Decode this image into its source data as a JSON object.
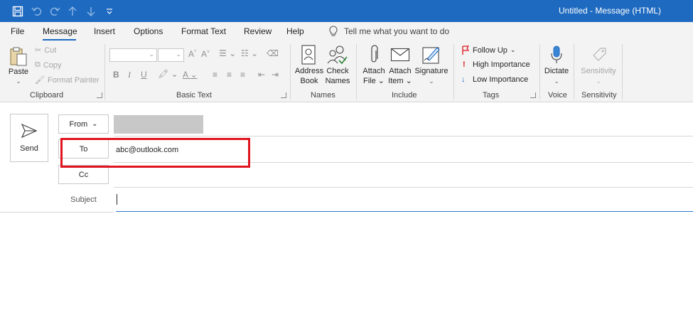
{
  "window": {
    "title": "Untitled  -  Message (HTML)"
  },
  "quick_access": {
    "icons": [
      "save-icon",
      "undo-icon",
      "redo-icon",
      "up-arrow-icon",
      "down-arrow-icon",
      "customize-icon"
    ]
  },
  "menu": {
    "tabs": [
      "File",
      "Message",
      "Insert",
      "Options",
      "Format Text",
      "Review",
      "Help"
    ],
    "active_tab": "Message",
    "tell_me": "Tell me what you want to do"
  },
  "ribbon": {
    "clipboard": {
      "label": "Clipboard",
      "paste": "Paste",
      "cut": "Cut",
      "copy": "Copy",
      "format_painter": "Format Painter"
    },
    "basic_text": {
      "label": "Basic Text",
      "bold": "B",
      "italic": "I",
      "underline": "U"
    },
    "names": {
      "label": "Names",
      "address_book_1": "Address",
      "address_book_2": "Book",
      "check_names_1": "Check",
      "check_names_2": "Names"
    },
    "include": {
      "label": "Include",
      "attach_file_1": "Attach",
      "attach_file_2": "File",
      "attach_item_1": "Attach",
      "attach_item_2": "Item",
      "signature": "Signature"
    },
    "tags": {
      "label": "Tags",
      "follow_up": "Follow Up",
      "high_importance": "High Importance",
      "low_importance": "Low Importance"
    },
    "voice": {
      "label": "Voice",
      "dictate": "Dictate"
    },
    "sensitivity": {
      "label": "Sensitivity",
      "button": "Sensitivity"
    }
  },
  "compose": {
    "send": "Send",
    "from_label": "From",
    "to_label": "To",
    "to_value": "abc@outlook.com",
    "cc_label": "Cc",
    "subject_label": "Subject",
    "subject_value": ""
  },
  "colors": {
    "title_bar": "#1e6ac0",
    "highlight": "#e0141e",
    "high_importance": "#e0141e",
    "low_importance": "#1e6ac0"
  }
}
